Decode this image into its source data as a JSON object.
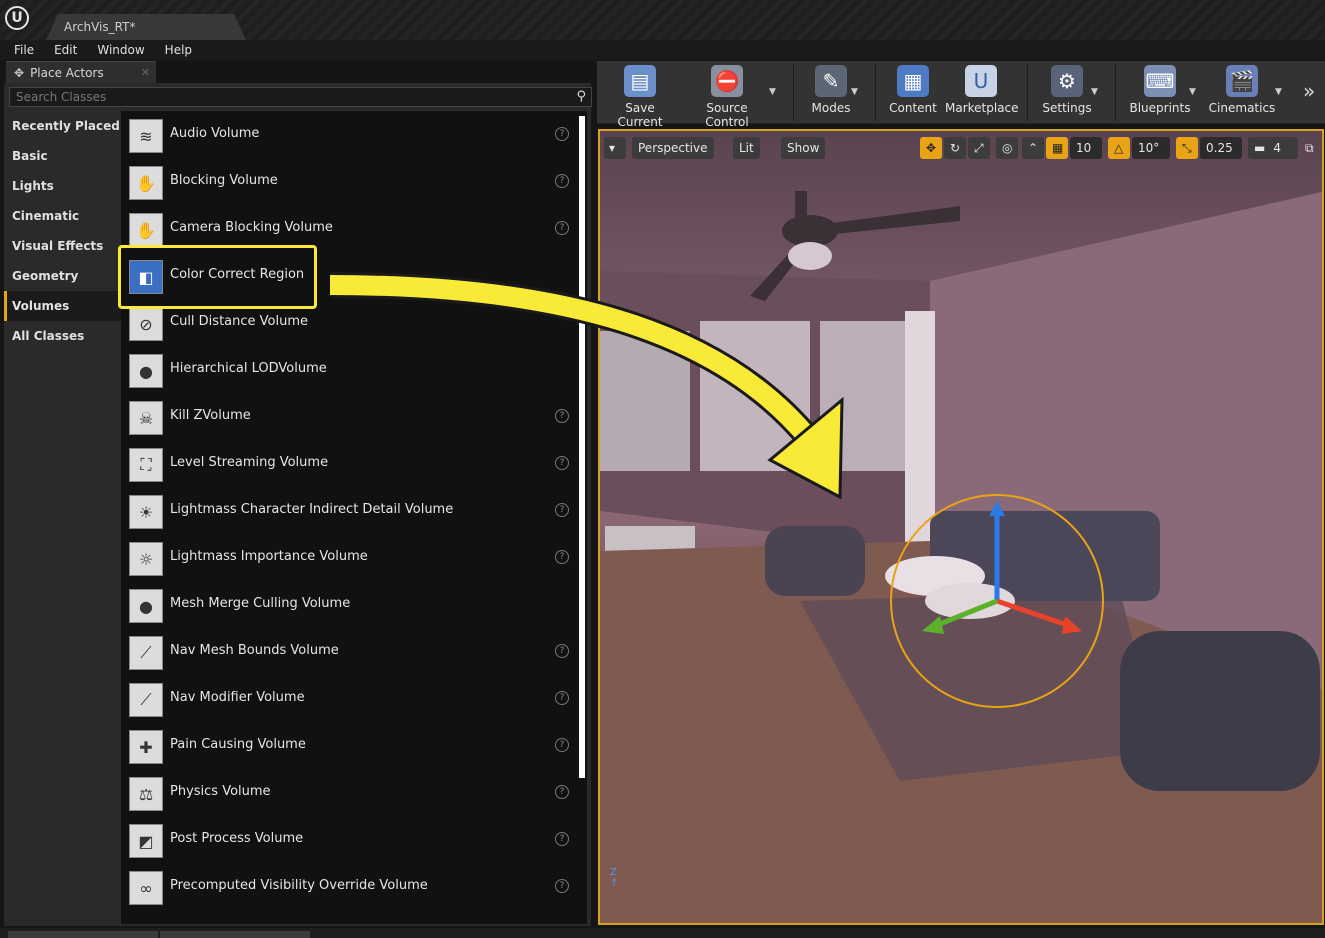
{
  "titlebar": {
    "project_tab": "ArchVis_RT*"
  },
  "menu": [
    "File",
    "Edit",
    "Window",
    "Help"
  ],
  "panel": {
    "tab_title": "Place Actors",
    "search_placeholder": "Search Classes",
    "categories": [
      "Recently Placed",
      "Basic",
      "Lights",
      "Cinematic",
      "Visual Effects",
      "Geometry",
      "Volumes",
      "All Classes"
    ],
    "active_category": "Volumes",
    "items": [
      {
        "label": "Audio Volume",
        "icon": "audio-volume-icon"
      },
      {
        "label": "Blocking Volume",
        "icon": "hand-icon"
      },
      {
        "label": "Camera Blocking Volume",
        "icon": "camera-hand-icon"
      },
      {
        "label": "Color Correct Region",
        "icon": "color-correct-icon"
      },
      {
        "label": "Cull Distance Volume",
        "icon": "cull-distance-icon"
      },
      {
        "label": "Hierarchical LODVolume",
        "icon": "sphere-icon"
      },
      {
        "label": "Kill ZVolume",
        "icon": "kill-z-icon"
      },
      {
        "label": "Level Streaming Volume",
        "icon": "level-streaming-icon"
      },
      {
        "label": "Lightmass Character Indirect Detail Volume",
        "icon": "sun-icon"
      },
      {
        "label": "Lightmass Importance Volume",
        "icon": "sun-small-icon"
      },
      {
        "label": "Mesh Merge Culling Volume",
        "icon": "sphere-icon"
      },
      {
        "label": "Nav Mesh Bounds Volume",
        "icon": "nav-mesh-icon"
      },
      {
        "label": "Nav Modifier Volume",
        "icon": "nav-modifier-icon"
      },
      {
        "label": "Pain Causing Volume",
        "icon": "pain-icon"
      },
      {
        "label": "Physics Volume",
        "icon": "weight-icon"
      },
      {
        "label": "Post Process Volume",
        "icon": "post-process-icon"
      },
      {
        "label": "Precomputed Visibility Override Volume",
        "icon": "glasses-icon"
      }
    ]
  },
  "toolbar": {
    "buttons": [
      {
        "label": "Save Current",
        "icon": "save-icon"
      },
      {
        "label": "Source Control",
        "icon": "source-control-icon"
      },
      {
        "label": "Modes",
        "icon": "modes-icon"
      },
      {
        "label": "Content",
        "icon": "content-icon"
      },
      {
        "label": "Marketplace",
        "icon": "marketplace-icon"
      },
      {
        "label": "Settings",
        "icon": "settings-icon"
      },
      {
        "label": "Blueprints",
        "icon": "blueprints-icon"
      },
      {
        "label": "Cinematics",
        "icon": "cinematics-icon"
      }
    ]
  },
  "viewport": {
    "view_mode": "Perspective",
    "lighting": "Lit",
    "show": "Show",
    "grid_snap": "10",
    "rotation_snap": "10°",
    "scale_snap": "0.25",
    "camera_speed": "4"
  },
  "colors": {
    "accent": "#e8a317",
    "highlight": "#f9ea38",
    "viewport_border": "#d9a21c"
  }
}
